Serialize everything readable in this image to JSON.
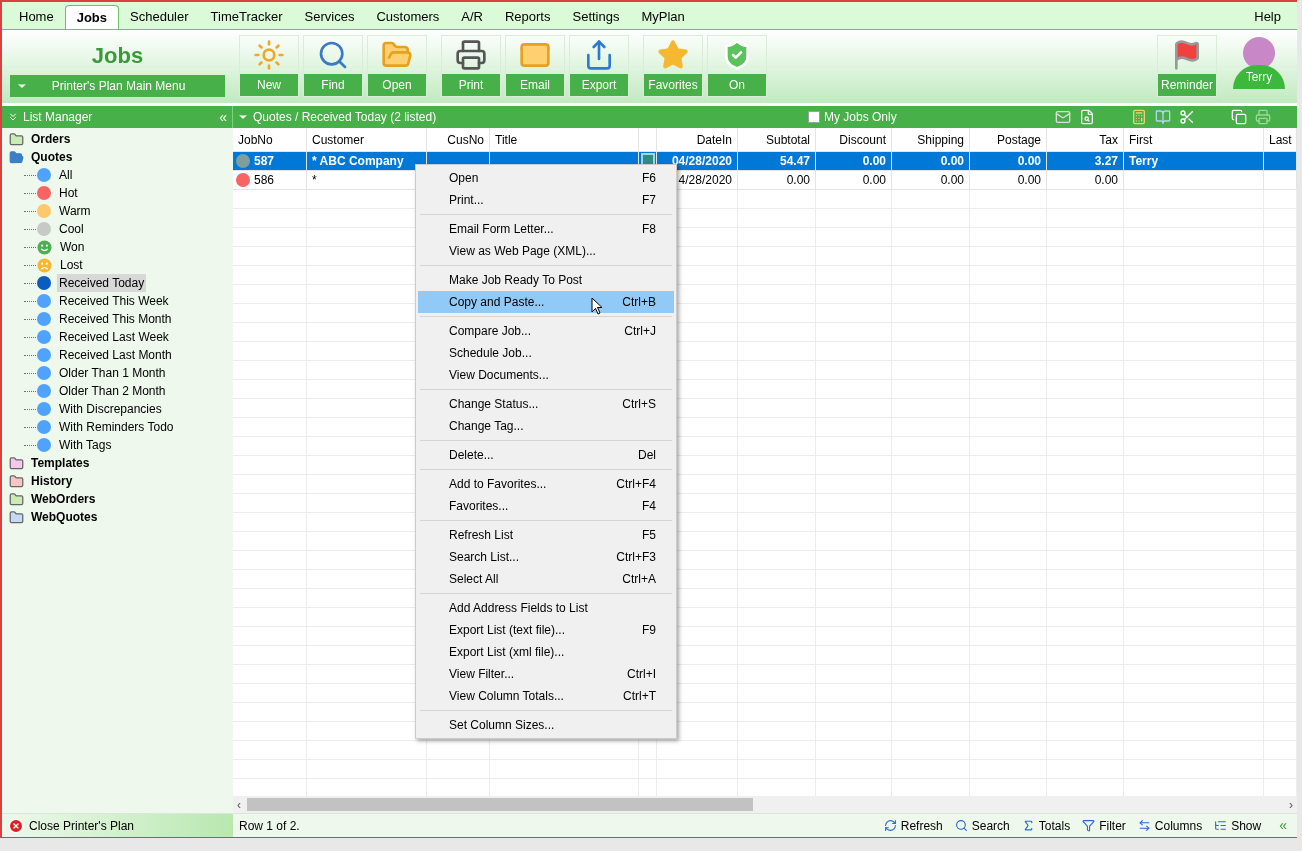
{
  "menu_tabs": [
    {
      "label": "Home",
      "selected": false
    },
    {
      "label": "Jobs",
      "selected": true
    },
    {
      "label": "Scheduler",
      "selected": false
    },
    {
      "label": "TimeTracker",
      "selected": false
    },
    {
      "label": "Services",
      "selected": false
    },
    {
      "label": "Customers",
      "selected": false
    },
    {
      "label": "A/R",
      "selected": false
    },
    {
      "label": "Reports",
      "selected": false
    },
    {
      "label": "Settings",
      "selected": false
    },
    {
      "label": "MyPlan",
      "selected": false
    }
  ],
  "help": "Help",
  "ribbon": {
    "title": "Jobs",
    "main_menu": "Printer's Plan Main Menu",
    "groups": [
      [
        "New",
        "Find",
        "Open"
      ],
      [
        "Print",
        "Email",
        "Export"
      ],
      [
        "Favorites",
        "On"
      ]
    ],
    "reminder": "Reminder",
    "user": "Terry"
  },
  "list_manager": {
    "title": "List Manager",
    "collapse": "«",
    "items": [
      {
        "label": "Orders",
        "color": "#c8ecb4",
        "expanded": false,
        "selected": false
      },
      {
        "label": "Quotes",
        "color": "#3b7fc4",
        "expanded": true,
        "selected": false,
        "children": [
          {
            "label": "All",
            "kind": "dot",
            "color": "#4fa3ff",
            "selected": false
          },
          {
            "label": "Hot",
            "kind": "dot",
            "color": "#f76464",
            "selected": false
          },
          {
            "label": "Warm",
            "kind": "dot",
            "color": "#ffc868",
            "selected": false
          },
          {
            "label": "Cool",
            "kind": "dot",
            "color": "#c8c8c8",
            "selected": false
          },
          {
            "label": "Won",
            "kind": "smile",
            "color": "#4caf50",
            "selected": false
          },
          {
            "label": "Lost",
            "kind": "frown",
            "color": "#f5b830",
            "selected": false
          },
          {
            "label": "Received Today",
            "kind": "dot",
            "color": "#0a5cc0",
            "selected": true
          },
          {
            "label": "Received This Week",
            "kind": "dot",
            "color": "#4fa3ff",
            "selected": false
          },
          {
            "label": "Received This Month",
            "kind": "dot",
            "color": "#4fa3ff",
            "selected": false
          },
          {
            "label": "Received Last Week",
            "kind": "dot",
            "color": "#4fa3ff",
            "selected": false
          },
          {
            "label": "Received Last Month",
            "kind": "dot",
            "color": "#4fa3ff",
            "selected": false
          },
          {
            "label": "Older Than 1 Month",
            "kind": "dot",
            "color": "#4fa3ff",
            "selected": false
          },
          {
            "label": "Older Than 2 Month",
            "kind": "dot",
            "color": "#4fa3ff",
            "selected": false
          },
          {
            "label": "With Discrepancies",
            "kind": "dot",
            "color": "#4fa3ff",
            "selected": false
          },
          {
            "label": "With Reminders Todo",
            "kind": "dot",
            "color": "#4fa3ff",
            "selected": false
          },
          {
            "label": "With Tags",
            "kind": "dot",
            "color": "#4fa3ff",
            "selected": false
          }
        ]
      },
      {
        "label": "Templates",
        "color": "#f4c8ee",
        "expanded": false,
        "selected": false
      },
      {
        "label": "History",
        "color": "#f8c4c4",
        "expanded": false,
        "selected": false
      },
      {
        "label": "WebOrders",
        "color": "#c8ecb4",
        "expanded": false,
        "selected": false
      },
      {
        "label": "WebQuotes",
        "color": "#c4daf4",
        "expanded": false,
        "selected": false
      }
    ]
  },
  "list": {
    "title": "Quotes / Received Today (2 listed)",
    "my_jobs_only": {
      "label": "My Jobs Only",
      "checked": false
    },
    "columns": [
      "JobNo",
      "Customer",
      "CusNo",
      "Title",
      "DateIn",
      "Subtotal",
      "Discount",
      "Shipping",
      "Postage",
      "Tax",
      "First",
      "Last"
    ],
    "rows": [
      {
        "selected": true,
        "color": "#7f9e9c",
        "attachment": true,
        "cells": [
          "587",
          "* ABC Company",
          null,
          null,
          "04/28/2020",
          "54.47",
          "0.00",
          "0.00",
          "0.00",
          "3.27",
          "Terry",
          null
        ]
      },
      {
        "selected": false,
        "color": "#f76464",
        "cells": [
          "586",
          "*",
          null,
          null,
          "4/28/2020",
          "0.00",
          "0.00",
          "0.00",
          "0.00",
          "0.00",
          null,
          null
        ]
      }
    ]
  },
  "scrollbar": {
    "left": "‹",
    "right": "›"
  },
  "context_menu": [
    [
      {
        "label": "Open",
        "shortcut": "F6",
        "selected": false
      },
      {
        "label": "Print...",
        "shortcut": "F7",
        "selected": false
      }
    ],
    [
      {
        "label": "Email Form Letter...",
        "shortcut": "F8",
        "selected": false
      },
      {
        "label": "View as Web Page (XML)...",
        "selected": false
      }
    ],
    [
      {
        "label": "Make Job Ready To Post",
        "selected": false
      },
      {
        "label": "Copy and Paste...",
        "shortcut": "Ctrl+B",
        "selected": true
      }
    ],
    [
      {
        "label": "Compare Job...",
        "shortcut": "Ctrl+J",
        "selected": false
      },
      {
        "label": "Schedule Job...",
        "selected": false
      },
      {
        "label": "View Documents...",
        "selected": false
      }
    ],
    [
      {
        "label": "Change Status...",
        "shortcut": "Ctrl+S",
        "selected": false
      },
      {
        "label": "Change Tag...",
        "selected": false
      }
    ],
    [
      {
        "label": "Delete...",
        "shortcut": "Del",
        "selected": false
      }
    ],
    [
      {
        "label": "Add to Favorites...",
        "shortcut": "Ctrl+F4",
        "selected": false
      },
      {
        "label": "Favorites...",
        "shortcut": "F4",
        "selected": false
      }
    ],
    [
      {
        "label": "Refresh List",
        "shortcut": "F5",
        "selected": false
      },
      {
        "label": "Search List...",
        "shortcut": "Ctrl+F3",
        "selected": false
      },
      {
        "label": "Select All",
        "shortcut": "Ctrl+A",
        "selected": false
      }
    ],
    [
      {
        "label": "Add Address Fields to List",
        "selected": false
      },
      {
        "label": "Export List (text file)...",
        "shortcut": "F9",
        "selected": false
      },
      {
        "label": "Export List (xml file)...",
        "selected": false
      },
      {
        "label": "View Filter...",
        "shortcut": "Ctrl+I",
        "selected": false
      },
      {
        "label": "View Column Totals...",
        "shortcut": "Ctrl+T",
        "selected": false
      }
    ],
    [
      {
        "label": "Set Column Sizes...",
        "selected": false
      }
    ]
  ],
  "status_bar": {
    "close": "Close Printer's Plan",
    "row_info": "Row 1 of 2.",
    "buttons": [
      "Refresh",
      "Search",
      "Totals",
      "Filter",
      "Columns",
      "Show"
    ],
    "collapse": "«"
  }
}
